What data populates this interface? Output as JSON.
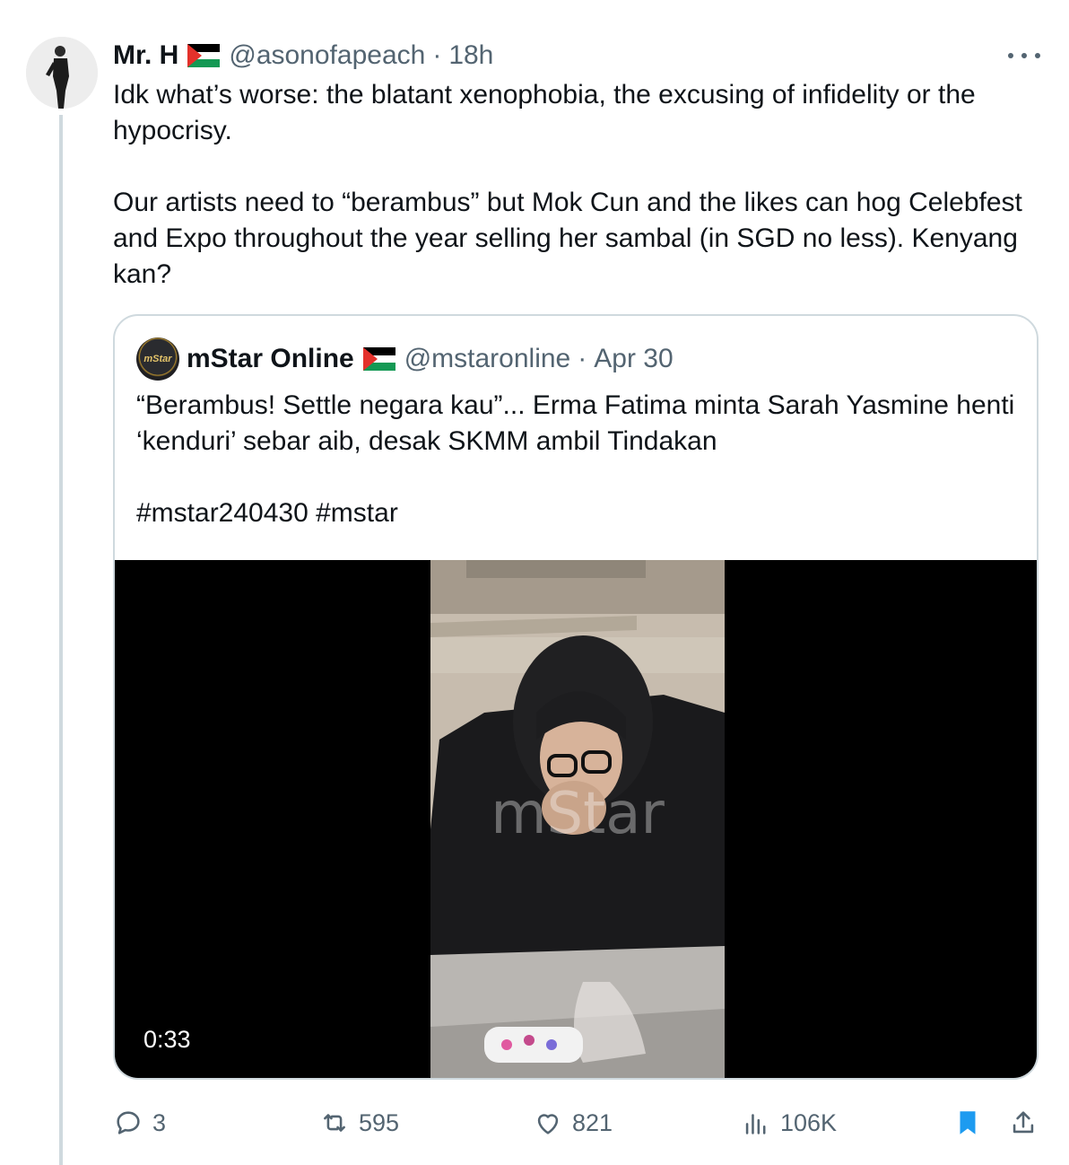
{
  "tweet": {
    "author_name": "Mr. H",
    "author_handle": "@asonofapeach",
    "separator": "·",
    "time": "18h",
    "text": "Idk what’s worse: the blatant xenophobia, the excusing of infidelity or the hypocrisy.\n\nOur artists need to “berambus” but Mok Cun and the likes can hog Celebfest and Expo throughout the year selling her sambal (in SGD no less). Kenyang kan?"
  },
  "quoted_tweet": {
    "avatar_text": "mStar",
    "author_name": "mStar Online",
    "author_handle": "@mstaronline",
    "separator": "·",
    "time": "Apr 30",
    "text": "“Berambus! Settle negara kau”... Erma Fatima minta Sarah Yasmine henti ‘kenduri’ sebar aib, desak SKMM ambil Tindakan\n\n#mstar240430 #mstar",
    "video": {
      "duration": "0:33",
      "watermark": "mStar"
    }
  },
  "actions": {
    "replies": "3",
    "retweets": "595",
    "likes": "821",
    "views": "106K"
  },
  "icons": {
    "reply": "reply-icon",
    "retweet": "retweet-icon",
    "like": "heart-icon",
    "views": "views-icon",
    "bookmark": "bookmark-icon",
    "share": "share-icon",
    "more": "more-icon",
    "flag": "palestine-flag-icon"
  },
  "colors": {
    "text": "#0f1419",
    "secondary": "#536471",
    "border": "#cfd9de",
    "bookmark": "#1d9bf0"
  }
}
